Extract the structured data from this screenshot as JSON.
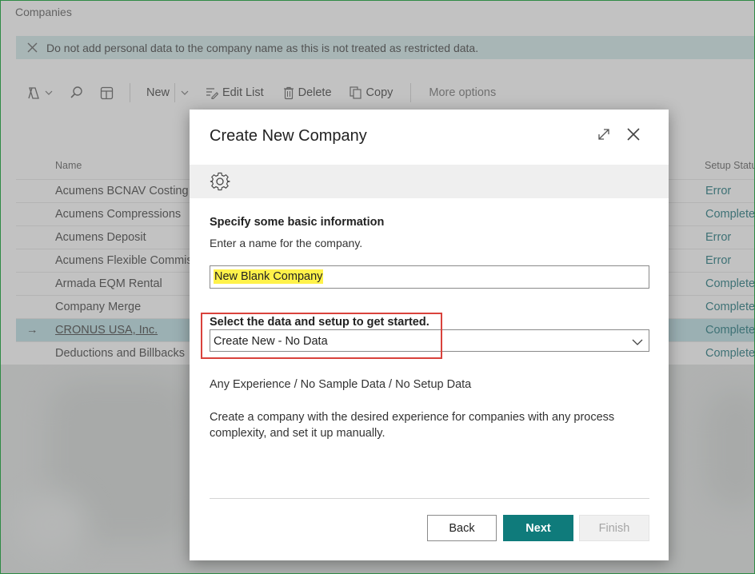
{
  "page": {
    "title": "Companies",
    "banner_text": "Do not add personal data to the company name as this is not treated as restricted data."
  },
  "toolbar": {
    "new_label": "New",
    "edit_list_label": "Edit List",
    "delete_label": "Delete",
    "copy_label": "Copy",
    "more_options_label": "More options"
  },
  "list": {
    "columns": [
      "Name",
      "Setup Status"
    ],
    "rows": [
      {
        "name": "Acumens BCNAV Costing",
        "status": "Error"
      },
      {
        "name": "Acumens Compressions",
        "status": "Completed"
      },
      {
        "name": "Acumens Deposit",
        "status": "Error"
      },
      {
        "name": "Acumens Flexible Commis",
        "status": "Error"
      },
      {
        "name": "Armada EQM Rental",
        "status": "Completed"
      },
      {
        "name": "Company Merge",
        "status": "Completed"
      },
      {
        "name": "CRONUS USA, Inc.",
        "status": "Completed",
        "selected": true
      },
      {
        "name": "Deductions and Billbacks",
        "status": "Completed"
      }
    ]
  },
  "dialog": {
    "title": "Create New Company",
    "section_title": "Specify some basic information",
    "section_subtitle": "Enter a name for the company.",
    "company_name_value": "New Blank Company",
    "select_label": "Select the data and setup to get started.",
    "select_value": "Create New - No Data",
    "experience_line": "Any Experience / No Sample Data / No Setup Data",
    "description": "Create a company with the desired experience for companies with any process complexity, and set it up manually.",
    "back_label": "Back",
    "next_label": "Next",
    "finish_label": "Finish"
  },
  "colors": {
    "accent": "#0f7b7b",
    "banner": "#cfe9ea",
    "selected_row": "#b8dfe4",
    "highlight": "#fff24a",
    "annotation_box": "#d9423c"
  }
}
